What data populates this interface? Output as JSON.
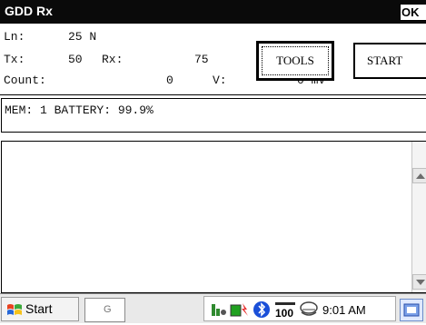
{
  "window": {
    "title": "GDD Rx",
    "ok_label": "OK"
  },
  "readouts": {
    "ln_label": "Ln:",
    "ln_value": "25 N",
    "tx_label": "Tx:",
    "tx_value": "50",
    "rx_label": "Rx:",
    "rx_value": "75",
    "count_label": "Count:",
    "count_value": "0",
    "v_label": "V:",
    "v_value": "0 mV"
  },
  "buttons": {
    "tools": "TOOLS",
    "start": "START"
  },
  "status": {
    "text": "MEM: 1 BATTERY: 99.9%"
  },
  "taskbar": {
    "start_label": "Start",
    "task_label": "G",
    "clock": "9:01 AM",
    "icons": [
      "windows-flag-icon",
      "connectivity-icon",
      "battery-icon",
      "bluetooth-icon",
      "volume-icon",
      "network-icon",
      "keyboard-icon"
    ]
  },
  "colors": {
    "titlebar": "#0a0a0a",
    "bluetooth": "#1a4fd8",
    "battery_green": "#20a020"
  }
}
